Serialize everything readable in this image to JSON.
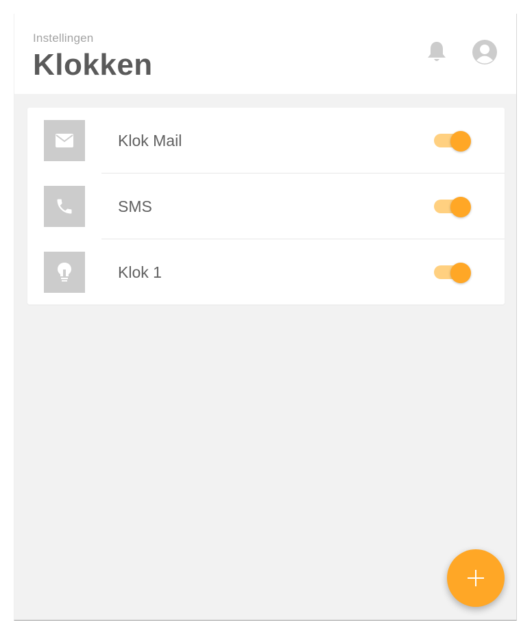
{
  "header": {
    "subtitle": "Instellingen",
    "title": "Klokken"
  },
  "icons": {
    "bell": "bell-icon",
    "avatar": "user-avatar-icon",
    "add": "plus-icon"
  },
  "items": [
    {
      "label": "Klok Mail",
      "icon": "mail-icon",
      "enabled": true
    },
    {
      "label": "SMS",
      "icon": "phone-icon",
      "enabled": true
    },
    {
      "label": "Klok 1",
      "icon": "lightbulb-icon",
      "enabled": true
    }
  ],
  "colors": {
    "accent": "#ffa726",
    "accent_light": "#ffd080",
    "tile": "#cccccc",
    "background": "#f2f2f2"
  }
}
